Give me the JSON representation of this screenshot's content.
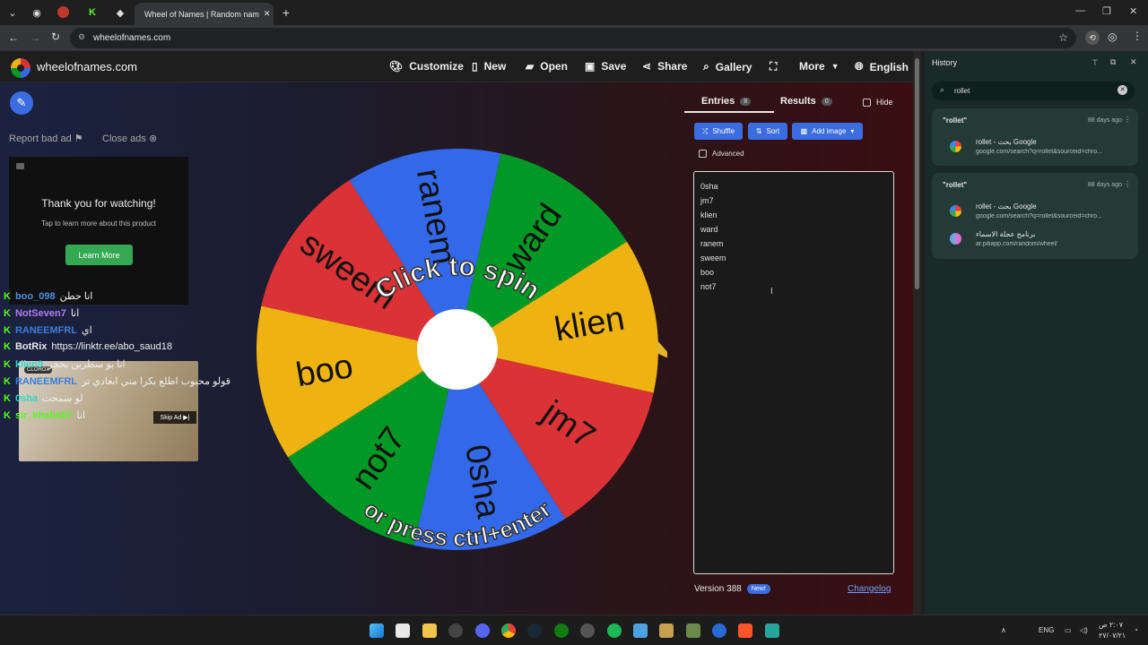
{
  "browser": {
    "active_tab_title": "Wheel of Names | Random nam",
    "address": "wheelofnames.com"
  },
  "site": {
    "brand": "wheelofnames.com",
    "nav": [
      "Customize",
      "New",
      "Open",
      "Save",
      "Share",
      "Gallery",
      "More",
      "English"
    ]
  },
  "ads": {
    "report": "Report bad ad",
    "close": "Close ads",
    "ad_title": "Thank you for watching!",
    "ad_subtitle": "Tap to learn more about this product",
    "learn_more": "Learn More",
    "skip": "Skip Ad"
  },
  "chat": [
    {
      "user": "boo_098",
      "msg": "انا حطن",
      "color": "#4a90e2"
    },
    {
      "user": "NotSeven7",
      "msg": "انا",
      "color": "#b07bf5"
    },
    {
      "user": "RANEEMFRL",
      "msg": "اي",
      "color": "#3b7dd8"
    },
    {
      "user": "BotRix",
      "msg": "https://linktr.ee/abo_saud18",
      "color": "#e8e8e8"
    },
    {
      "user": "klien9",
      "msg": "انا بو سطرين بحجر",
      "color": "#35d4c6"
    },
    {
      "user": "RANEEMFRL",
      "msg": "قولو محبوب اطلع بكرا مني ابعادي تر",
      "color": "#3b7dd8"
    },
    {
      "user": "0sha",
      "msg": "لو سمحت",
      "color": "#35d4c6"
    },
    {
      "user": "sir_khalid57",
      "msg": "انا",
      "color": "#53fc18"
    }
  ],
  "wheel": {
    "segments": [
      {
        "name": "klien",
        "color": "#eeb211"
      },
      {
        "name": "jm7",
        "color": "#db3236"
      },
      {
        "name": "0sha",
        "color": "#3369e8"
      },
      {
        "name": "not7",
        "color": "#009925"
      },
      {
        "name": "boo",
        "color": "#eeb211"
      },
      {
        "name": "sweem",
        "color": "#db3236"
      },
      {
        "name": "ranem",
        "color": "#3369e8"
      },
      {
        "name": "ward",
        "color": "#009925"
      }
    ],
    "top_text": "Click to spin",
    "bottom_text": "or press ctrl+enter"
  },
  "panel": {
    "entries_tab": "Entries",
    "entries_count": "8",
    "results_tab": "Results",
    "results_count": "0",
    "hide": "Hide",
    "shuffle": "Shuffle",
    "sort": "Sort",
    "add_image": "Add image",
    "advanced": "Advanced",
    "entries": [
      "0sha",
      "jm7",
      "klien",
      "ward",
      "ranem",
      "sweem",
      "boo",
      "not7"
    ],
    "version": "Version 388",
    "new_badge": "New!",
    "changelog": "Changelog"
  },
  "history": {
    "title": "History",
    "search_value": "rollet",
    "groups": [
      {
        "query": "\"rollet\"",
        "date": "88 days ago",
        "items": [
          {
            "title": "rollet - بحث Google",
            "url": "google.com/search?q=rollet&sourceid=chro..."
          }
        ]
      },
      {
        "query": "\"rollet\"",
        "date": "88 days ago",
        "items": [
          {
            "title": "rollet - بحث Google",
            "url": "google.com/search?q=rollet&sourceid=chro..."
          },
          {
            "title": "برنامج عجلة الاسماء",
            "url": "ar.piliapp.com/random/wheel/"
          }
        ]
      }
    ]
  },
  "taskbar": {
    "lang": "ENG",
    "time": "٢:٠٧ ص",
    "date": "٢٧/٠٧/٢١"
  }
}
